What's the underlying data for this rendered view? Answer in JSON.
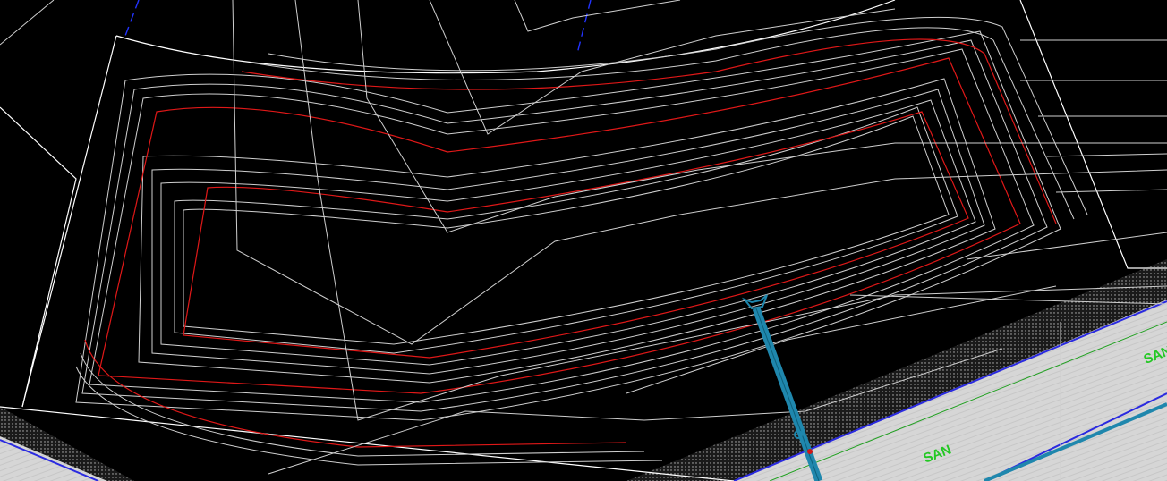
{
  "drawing": {
    "background": "#000000",
    "colors": {
      "contour": "#cfcfcf",
      "contour_major": "#e01818",
      "boundary": "#ffffff",
      "right_of_way": "#2233ff",
      "road_edge": "#2a2ae0",
      "road_hatch": "#d9d9d9",
      "sanitary_sewer": "#22a022",
      "storm_pipe": "#1f87ad"
    },
    "labels": {
      "sewer_label_1": "SAN",
      "sewer_label_2": "SAN"
    },
    "icons": {
      "pipe_end": "flared-end-section-icon"
    }
  }
}
